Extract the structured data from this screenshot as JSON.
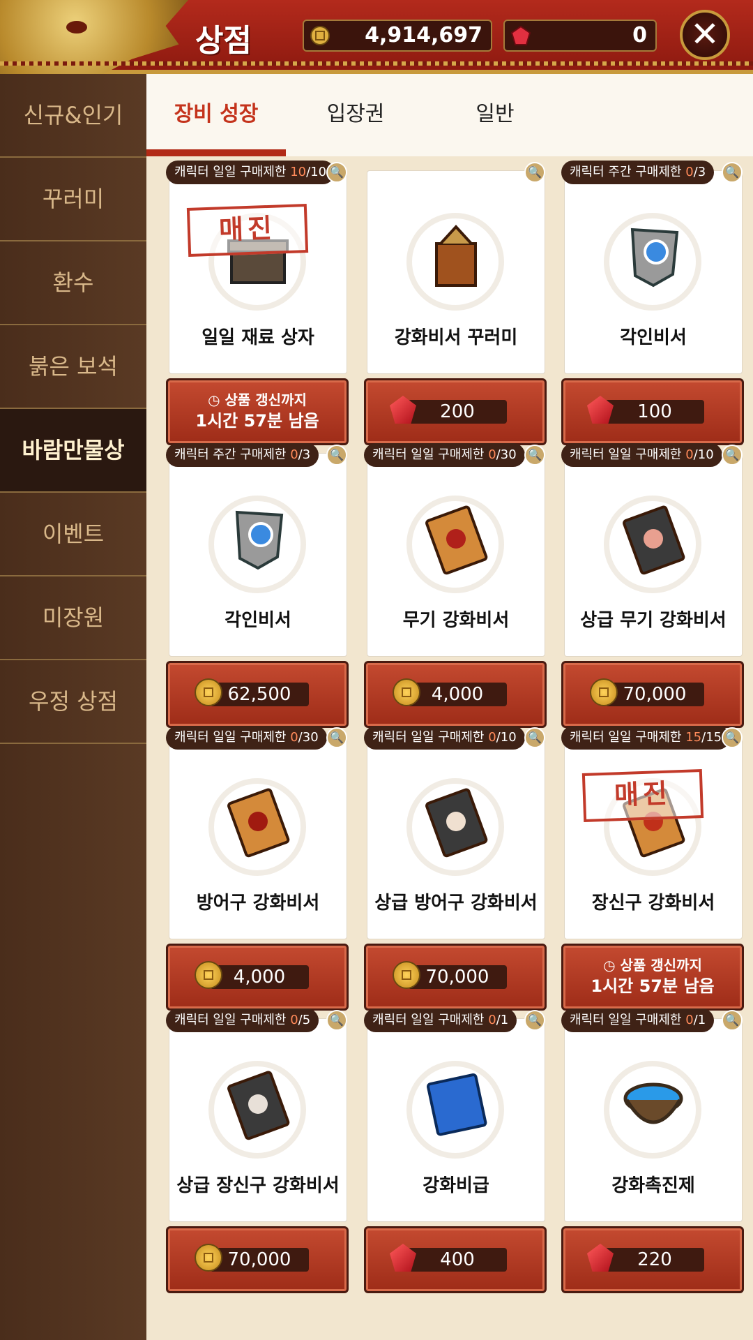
{
  "header": {
    "title": "상점",
    "gold": "4,914,697",
    "gems": "0"
  },
  "sidebar": {
    "items": [
      {
        "label": "신규&인기"
      },
      {
        "label": "꾸러미"
      },
      {
        "label": "환수"
      },
      {
        "label": "붉은 보석"
      },
      {
        "label": "바람만물상",
        "active": true
      },
      {
        "label": "이벤트"
      },
      {
        "label": "미장원"
      },
      {
        "label": "우정 상점"
      }
    ]
  },
  "tabs": [
    {
      "label": "장비 성장",
      "active": true
    },
    {
      "label": "입장권"
    },
    {
      "label": "일반"
    }
  ],
  "labels": {
    "soldout": "매진",
    "renew_1": "상품 갱신까지",
    "renew_2": "1시간 57분 남음"
  },
  "items": [
    {
      "limit": "캐릭터 일일 구매제한",
      "count": "10",
      "max": "/10",
      "name": "일일 재료 상자",
      "soldout": true,
      "icon": "box-icon"
    },
    {
      "name": "강화비서 꾸러미",
      "price": "200",
      "currency": "gem",
      "icon": "bundle-icon"
    },
    {
      "limit": "캐릭터 주간 구매제한",
      "count": "0",
      "max": "/3",
      "name": "각인비서",
      "price": "100",
      "currency": "gem",
      "icon": "scroll-blue-icon"
    },
    {
      "limit": "캐릭터 주간 구매제한",
      "count": "0",
      "max": "/3",
      "name": "각인비서",
      "price": "62,500",
      "currency": "gold",
      "icon": "scroll-blue-icon"
    },
    {
      "limit": "캐릭터 일일 구매제한",
      "count": "0",
      "max": "/30",
      "name": "무기 강화비서",
      "price": "4,000",
      "currency": "gold",
      "icon": "scroll-weapon-icon"
    },
    {
      "limit": "캐릭터 일일 구매제한",
      "count": "0",
      "max": "/10",
      "name": "상급 무기 강화비서",
      "price": "70,000",
      "currency": "gold",
      "icon": "scroll-weapon-adv-icon"
    },
    {
      "limit": "캐릭터 일일 구매제한",
      "count": "0",
      "max": "/30",
      "name": "방어구 강화비서",
      "price": "4,000",
      "currency": "gold",
      "icon": "scroll-armor-icon"
    },
    {
      "limit": "캐릭터 일일 구매제한",
      "count": "0",
      "max": "/10",
      "name": "상급 방어구 강화비서",
      "price": "70,000",
      "currency": "gold",
      "icon": "scroll-armor-adv-icon"
    },
    {
      "limit": "캐릭터 일일 구매제한",
      "count": "15",
      "max": "/15",
      "name": "장신구 강화비서",
      "soldout": true,
      "icon": "scroll-accessory-icon"
    },
    {
      "limit": "캐릭터 일일 구매제한",
      "count": "0",
      "max": "/5",
      "name": "상급 장신구 강화비서",
      "price": "70,000",
      "currency": "gold",
      "icon": "scroll-accessory-adv-icon"
    },
    {
      "limit": "캐릭터 일일 구매제한",
      "count": "0",
      "max": "/1",
      "name": "강화비급",
      "price": "400",
      "currency": "gem",
      "icon": "book-icon"
    },
    {
      "limit": "캐릭터 일일 구매제한",
      "count": "0",
      "max": "/1",
      "name": "강화촉진제",
      "price": "220",
      "currency": "gem",
      "icon": "bowl-icon"
    }
  ],
  "colors": {
    "accent": "#c4331c",
    "button": "#b23a22",
    "sidebar": "#4a2d1b"
  }
}
